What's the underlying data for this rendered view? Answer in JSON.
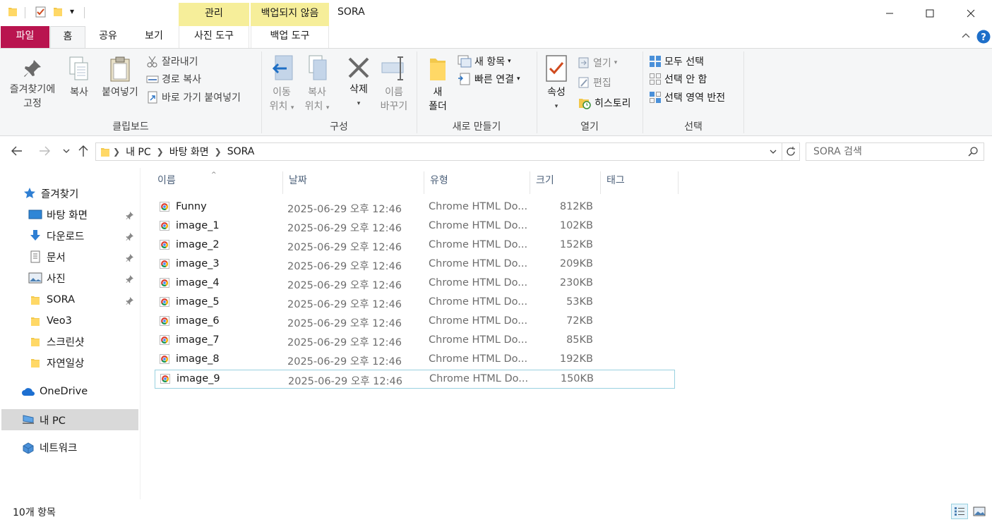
{
  "title_bar": {
    "window_title": "SORA",
    "quick_access_dropdown": "▾",
    "context_tabs": [
      {
        "label": "관리",
        "color": "#f6ee9a"
      },
      {
        "label": "백업되지 않음",
        "color": "#f6ee9a"
      }
    ],
    "window_buttons": [
      "minimize",
      "maximize",
      "close"
    ]
  },
  "tabs": {
    "file": "파일",
    "home": "홈",
    "share": "공유",
    "view": "보기",
    "picture_tools": "사진 도구",
    "backup_tools": "백업 도구"
  },
  "ribbon": {
    "clipboard": {
      "label": "클립보드",
      "pin_line1": "즐겨찾기에",
      "pin_line2": "고정",
      "copy": "복사",
      "paste": "붙여넣기",
      "cut": "잘라내기",
      "copy_path": "경로 복사",
      "paste_shortcut": "바로 가기 붙여넣기"
    },
    "organize": {
      "label": "구성",
      "move_line1": "이동",
      "move_line2": "위치",
      "copy_line1": "복사",
      "copy_line2": "위치",
      "delete": "삭제",
      "rename_line1": "이름",
      "rename_line2": "바꾸기"
    },
    "new": {
      "label": "새로 만들기",
      "folder_line1": "새",
      "folder_line2": "폴더",
      "new_item": "새 항목",
      "easy_access": "빠른 연결"
    },
    "open": {
      "label": "열기",
      "properties": "속성",
      "open": "열기",
      "edit": "편집",
      "history": "히스토리"
    },
    "select": {
      "label": "선택",
      "select_all": "모두 선택",
      "select_none": "선택 안 함",
      "invert": "선택 영역 반전"
    }
  },
  "address": {
    "crumbs": [
      "내 PC",
      "바탕 화면",
      "SORA"
    ],
    "search_placeholder": "SORA 검색"
  },
  "nav": {
    "quick_access": "즐겨찾기",
    "items": [
      {
        "label": "바탕 화면",
        "icon": "desktop-icon",
        "pinned": true
      },
      {
        "label": "다운로드",
        "icon": "download-icon",
        "pinned": true
      },
      {
        "label": "문서",
        "icon": "document-icon",
        "pinned": true
      },
      {
        "label": "사진",
        "icon": "picture-icon",
        "pinned": true
      },
      {
        "label": "SORA",
        "icon": "folder-icon",
        "pinned": true
      },
      {
        "label": "Veo3",
        "icon": "folder-icon",
        "pinned": false
      },
      {
        "label": "스크린샷",
        "icon": "folder-icon",
        "pinned": false
      },
      {
        "label": "자연일상",
        "icon": "folder-icon",
        "pinned": false
      }
    ],
    "onedrive": "OneDrive",
    "this_pc": "내 PC",
    "network": "네트워크"
  },
  "columns": {
    "name": "이름",
    "date": "날짜",
    "type": "유형",
    "size": "크기",
    "tags": "태그"
  },
  "files": [
    {
      "name": "Funny",
      "date": "2025-06-29 오후 12:46",
      "type": "Chrome HTML Do...",
      "size": "812KB"
    },
    {
      "name": "image_1",
      "date": "2025-06-29 오후 12:46",
      "type": "Chrome HTML Do...",
      "size": "102KB"
    },
    {
      "name": "image_2",
      "date": "2025-06-29 오후 12:46",
      "type": "Chrome HTML Do...",
      "size": "152KB"
    },
    {
      "name": "image_3",
      "date": "2025-06-29 오후 12:46",
      "type": "Chrome HTML Do...",
      "size": "209KB"
    },
    {
      "name": "image_4",
      "date": "2025-06-29 오후 12:46",
      "type": "Chrome HTML Do...",
      "size": "230KB"
    },
    {
      "name": "image_5",
      "date": "2025-06-29 오후 12:46",
      "type": "Chrome HTML Do...",
      "size": "53KB"
    },
    {
      "name": "image_6",
      "date": "2025-06-29 오후 12:46",
      "type": "Chrome HTML Do...",
      "size": "72KB"
    },
    {
      "name": "image_7",
      "date": "2025-06-29 오후 12:46",
      "type": "Chrome HTML Do...",
      "size": "85KB"
    },
    {
      "name": "image_8",
      "date": "2025-06-29 오후 12:46",
      "type": "Chrome HTML Do...",
      "size": "192KB"
    },
    {
      "name": "image_9",
      "date": "2025-06-29 오후 12:46",
      "type": "Chrome HTML Do...",
      "size": "150KB"
    }
  ],
  "status": {
    "item_count": "10개 항목"
  },
  "colors": {
    "file_tab": "#b9144f",
    "context_tab": "#f6ee9a",
    "selection_border": "#99d1e0",
    "nav_selected": "#d9d9d9",
    "column_header_text": "#4c607a"
  }
}
